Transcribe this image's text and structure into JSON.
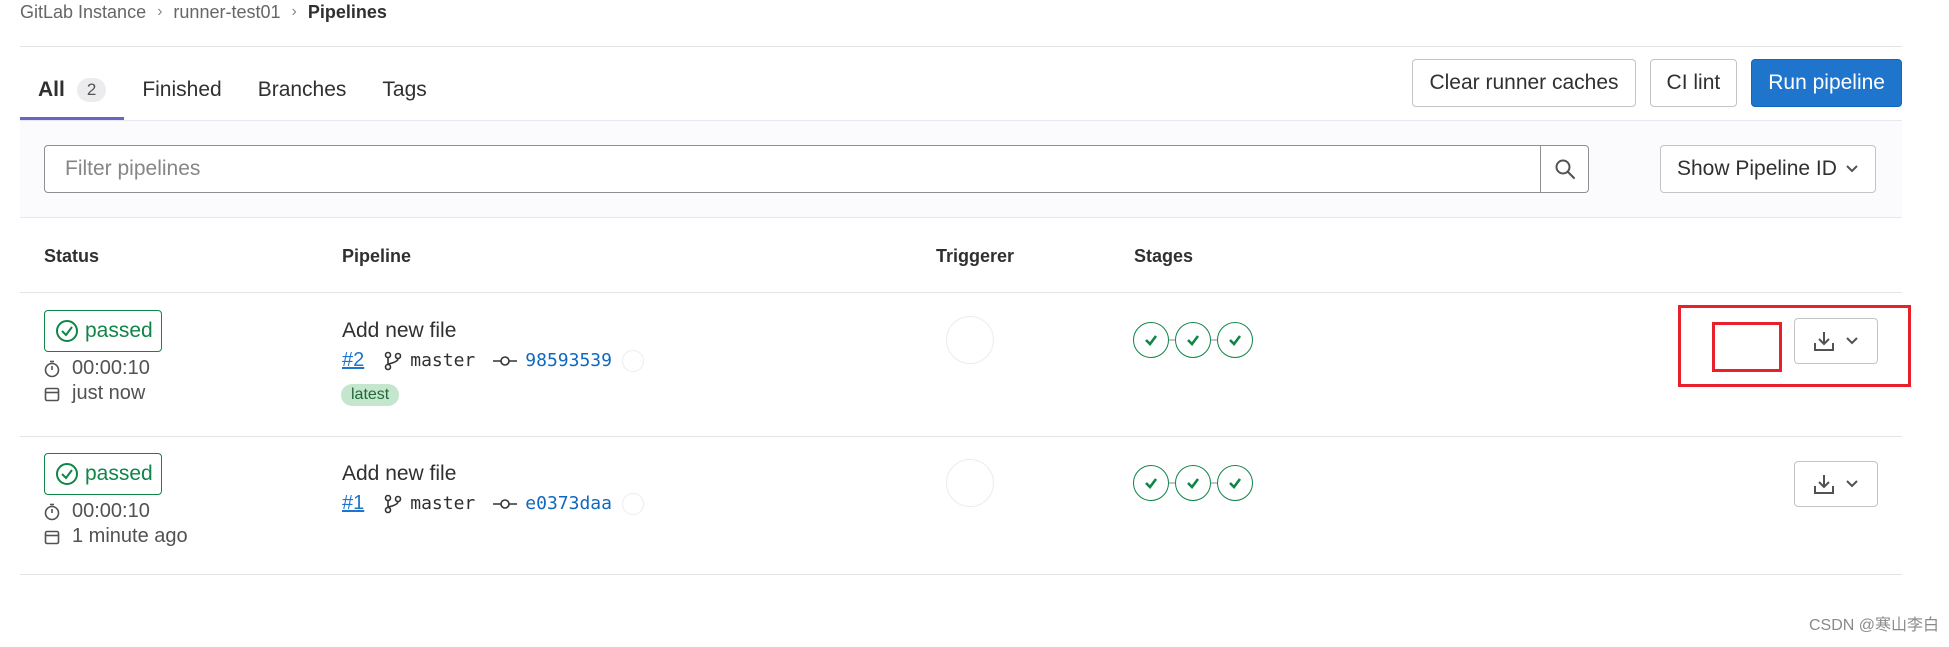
{
  "breadcrumb": {
    "items": [
      "GitLab Instance",
      "runner-test01"
    ],
    "current": "Pipelines"
  },
  "tabs": [
    {
      "label": "All",
      "count": "2",
      "active": true
    },
    {
      "label": "Finished"
    },
    {
      "label": "Branches"
    },
    {
      "label": "Tags"
    }
  ],
  "actions": {
    "clear_caches": "Clear runner caches",
    "ci_lint": "CI lint",
    "run_pipeline": "Run pipeline"
  },
  "filter": {
    "placeholder": "Filter pipelines",
    "pipeline_id_dropdown": "Show Pipeline ID"
  },
  "table": {
    "headers": {
      "status": "Status",
      "pipeline": "Pipeline",
      "triggerer": "Triggerer",
      "stages": "Stages"
    },
    "rows": [
      {
        "status": "passed",
        "duration": "00:00:10",
        "finished": "just now",
        "title": "Add new file",
        "id": "#2",
        "ref": "master",
        "sha": "98593539",
        "badge": "latest"
      },
      {
        "status": "passed",
        "duration": "00:00:10",
        "finished": "1 minute ago",
        "title": "Add new file",
        "id": "#1",
        "ref": "master",
        "sha": "e0373daa"
      }
    ]
  },
  "colors": {
    "success": "#108548",
    "primary": "#1f75cb",
    "annotation": "#e8202a"
  },
  "watermark": "CSDN @寒山李白"
}
